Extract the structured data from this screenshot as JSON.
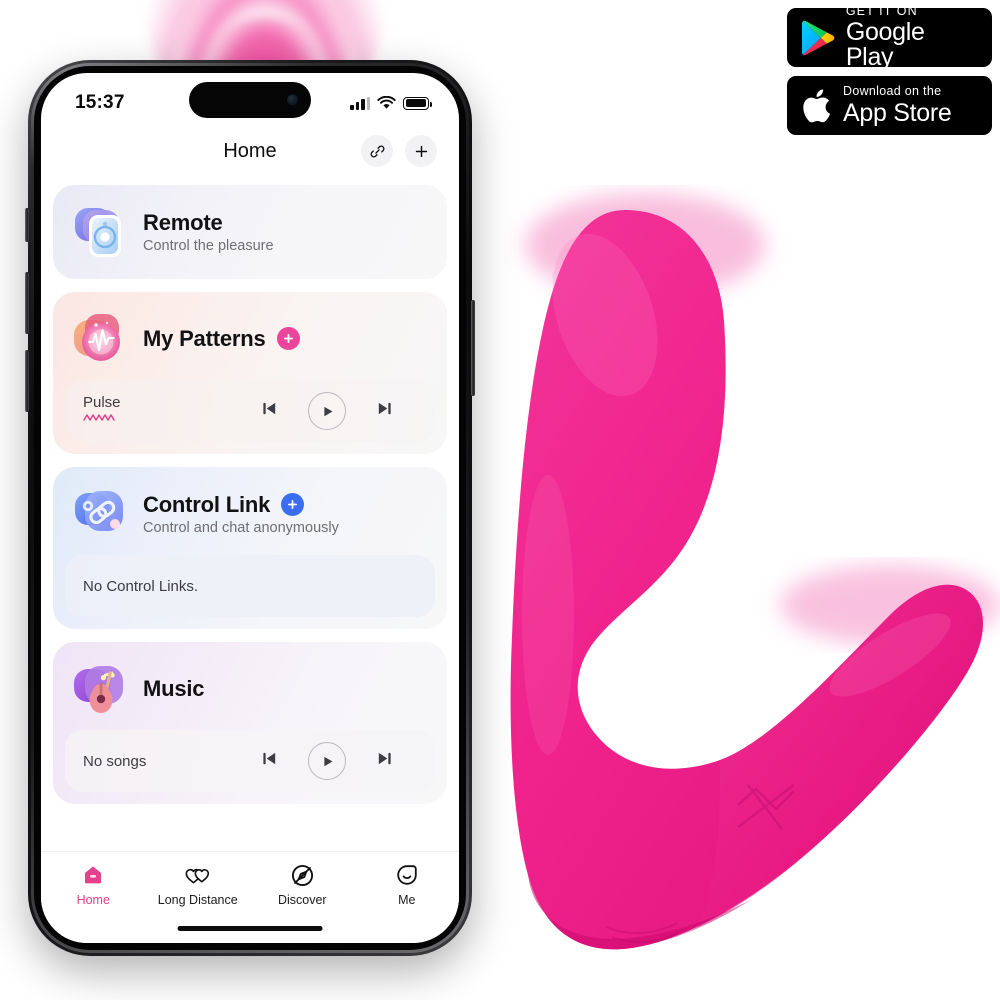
{
  "phone": {
    "status_bar": {
      "time": "15:37",
      "signal_icon": "cellular-bars-icon",
      "wifi_icon": "wifi-icon",
      "battery_icon": "battery-full-icon"
    },
    "nav": {
      "title": "Home",
      "link_icon": "link-icon",
      "add_icon": "plus-icon"
    },
    "cards": [
      {
        "id": "remote",
        "title": "Remote",
        "subtitle": "Control the pleasure",
        "icon": "remote-control-icon",
        "has_plus": false,
        "footer": null
      },
      {
        "id": "my-patterns",
        "title": "My Patterns",
        "subtitle": "",
        "icon": "pattern-waveform-icon",
        "has_plus": true,
        "plus_color": "#e8459b",
        "footer": {
          "label": "Pulse",
          "waveform_icon": "zigzag-waveform-icon",
          "prev_icon": "skip-previous-icon",
          "play_icon": "play-icon",
          "next_icon": "skip-next-icon"
        }
      },
      {
        "id": "control-link",
        "title": "Control Link",
        "subtitle": "Control and chat anonymously",
        "icon": "chain-link-icon",
        "has_plus": true,
        "plus_color": "#3b6df0",
        "footer": {
          "label": "No Control Links."
        }
      },
      {
        "id": "music",
        "title": "Music",
        "subtitle": "",
        "icon": "guitar-music-icon",
        "has_plus": false,
        "footer": {
          "label": "No songs",
          "prev_icon": "skip-previous-icon",
          "play_icon": "play-icon",
          "next_icon": "skip-next-icon"
        }
      }
    ],
    "tabs": [
      {
        "label": "Home",
        "icon": "home-icon",
        "active": true
      },
      {
        "label": "Long Distance",
        "icon": "two-hearts-icon",
        "active": false
      },
      {
        "label": "Discover",
        "icon": "compass-icon",
        "active": false
      },
      {
        "label": "Me",
        "icon": "smiley-face-icon",
        "active": false
      }
    ]
  },
  "badges": [
    {
      "id": "google-play",
      "top_line": "GET IT ON",
      "bottom_line": "Google Play",
      "icon": "google-play-icon"
    },
    {
      "id": "app-store",
      "top_line": "Download on the",
      "bottom_line": "App Store",
      "icon": "apple-logo-icon"
    }
  ],
  "product": {
    "name": "pink-wearable-vibrator",
    "color": "#F0228C",
    "highlight": "#F9C6E0"
  },
  "colors": {
    "accent_pink": "#e2418c",
    "product_pink": "#F0228C",
    "blue_accent": "#3b6df0"
  }
}
